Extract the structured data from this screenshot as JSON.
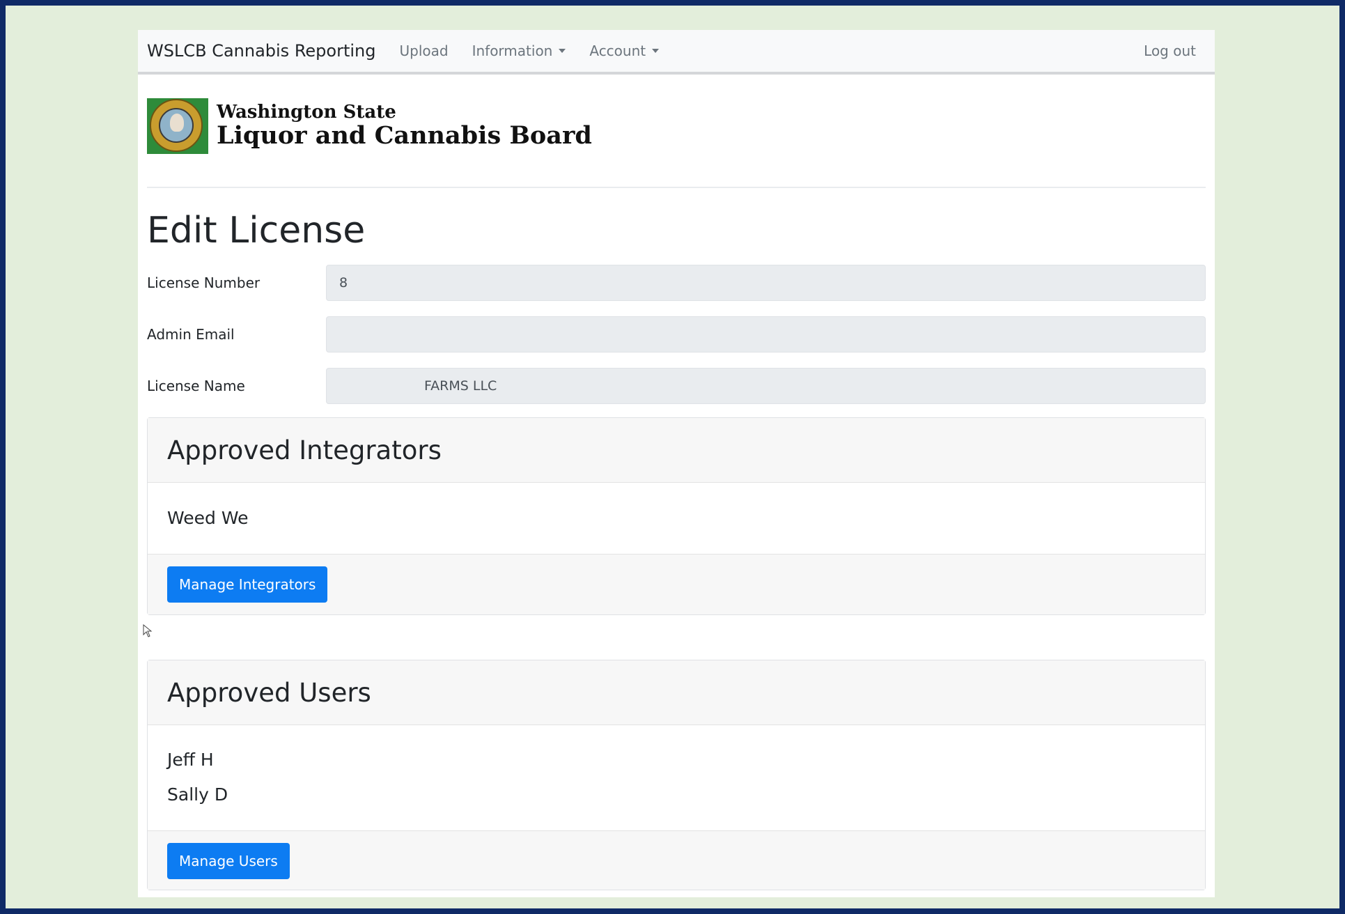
{
  "navbar": {
    "brand": "WSLCB Cannabis Reporting",
    "links": {
      "upload": "Upload",
      "information": "Information",
      "account": "Account",
      "logout": "Log out"
    }
  },
  "header": {
    "org_line1": "Washington State",
    "org_line2": "Liquor and Cannabis Board",
    "seal_icon": "state-seal-icon"
  },
  "page": {
    "title": "Edit License"
  },
  "form": {
    "license_number": {
      "label": "License Number",
      "value": "8"
    },
    "admin_email": {
      "label": "Admin Email",
      "value": ""
    },
    "license_name": {
      "label": "License Name",
      "value": "FARMS LLC"
    }
  },
  "integrators": {
    "title": "Approved Integrators",
    "items": [
      "Weed We"
    ],
    "button_label": "Manage Integrators"
  },
  "users": {
    "title": "Approved Users",
    "items": [
      "Jeff H",
      "Sally D"
    ],
    "button_label": "Manage Users"
  },
  "colors": {
    "frame": "#0f2a66",
    "background": "#e3eedb",
    "primary_button": "#0d7cf2"
  }
}
